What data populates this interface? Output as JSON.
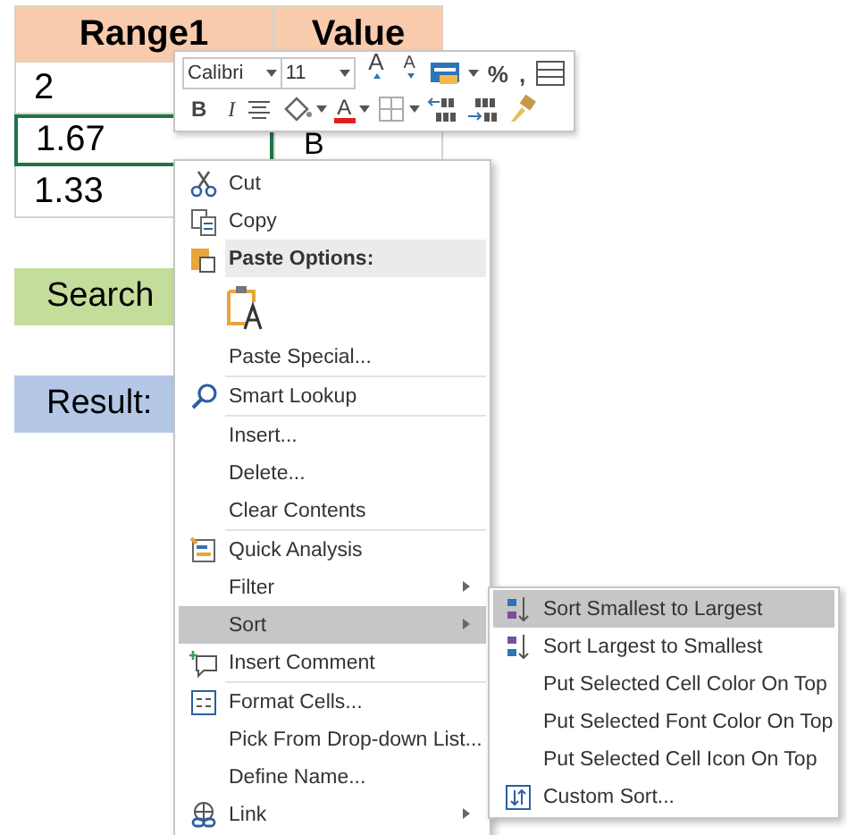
{
  "sheet": {
    "columns": [
      "Range1",
      "Value"
    ],
    "rows": [
      {
        "range": "2",
        "selected": false
      },
      {
        "range": "1.67",
        "value": "B",
        "selected": true
      },
      {
        "range": "1.33",
        "selected": false
      }
    ],
    "search_label": "Search",
    "result_label": "Result:"
  },
  "mini_toolbar": {
    "font": "Calibri",
    "size": "11",
    "row1": [
      {
        "kind": "grow",
        "label": "A"
      },
      {
        "kind": "shrink",
        "label": "A"
      },
      {
        "kind": "table",
        "caret": true
      },
      {
        "kind": "text",
        "label": "%"
      },
      {
        "kind": "text",
        "label": ","
      },
      {
        "kind": "wrap"
      }
    ],
    "row2": [
      {
        "kind": "bold",
        "label": "B"
      },
      {
        "kind": "italic",
        "label": "I"
      },
      {
        "kind": "align"
      },
      {
        "kind": "fill",
        "caret": true
      },
      {
        "kind": "fontcolor",
        "label": "A",
        "caret": true,
        "color": "#e02020"
      },
      {
        "kind": "borders",
        "caret": true
      },
      {
        "kind": "incdec"
      },
      {
        "kind": "decdec"
      },
      {
        "kind": "painter"
      }
    ]
  },
  "context_menu": {
    "items": [
      {
        "kind": "item",
        "label": "Cut",
        "selected": false
      },
      {
        "kind": "item",
        "label": "Copy",
        "selected": false
      },
      {
        "kind": "header",
        "label": "Paste Options:"
      },
      {
        "kind": "paste-icons"
      },
      {
        "kind": "item",
        "label": "Paste Special...",
        "selected": false
      },
      {
        "kind": "item",
        "label": "Smart Lookup",
        "separator": true,
        "selected": false
      },
      {
        "kind": "item",
        "label": "Insert...",
        "separator": true,
        "selected": false
      },
      {
        "kind": "item",
        "label": "Delete...",
        "selected": false
      },
      {
        "kind": "item",
        "label": "Clear Contents",
        "selected": false
      },
      {
        "kind": "item",
        "label": "Quick Analysis",
        "separator": true,
        "selected": false
      },
      {
        "kind": "item",
        "label": "Filter",
        "submenu": true,
        "selected": false
      },
      {
        "kind": "item",
        "label": "Sort",
        "submenu": true,
        "selected": true
      },
      {
        "kind": "item",
        "label": "Insert Comment",
        "selected": false
      },
      {
        "kind": "item",
        "label": "Format Cells...",
        "separator": true,
        "selected": false
      },
      {
        "kind": "item",
        "label": "Pick From Drop-down List...",
        "selected": false
      },
      {
        "kind": "item",
        "label": "Define Name...",
        "selected": false
      },
      {
        "kind": "item",
        "label": "Link",
        "submenu": true,
        "selected": false
      }
    ]
  },
  "sort_submenu": {
    "items": [
      {
        "label": "Sort Smallest to Largest",
        "selected": true
      },
      {
        "label": "Sort Largest to Smallest",
        "selected": false
      },
      {
        "label": "Put Selected Cell Color On Top",
        "selected": false
      },
      {
        "label": "Put Selected Font Color On Top",
        "selected": false
      },
      {
        "label": "Put Selected Cell Icon On Top",
        "selected": false
      },
      {
        "label": "Custom Sort...",
        "selected": false
      }
    ]
  }
}
